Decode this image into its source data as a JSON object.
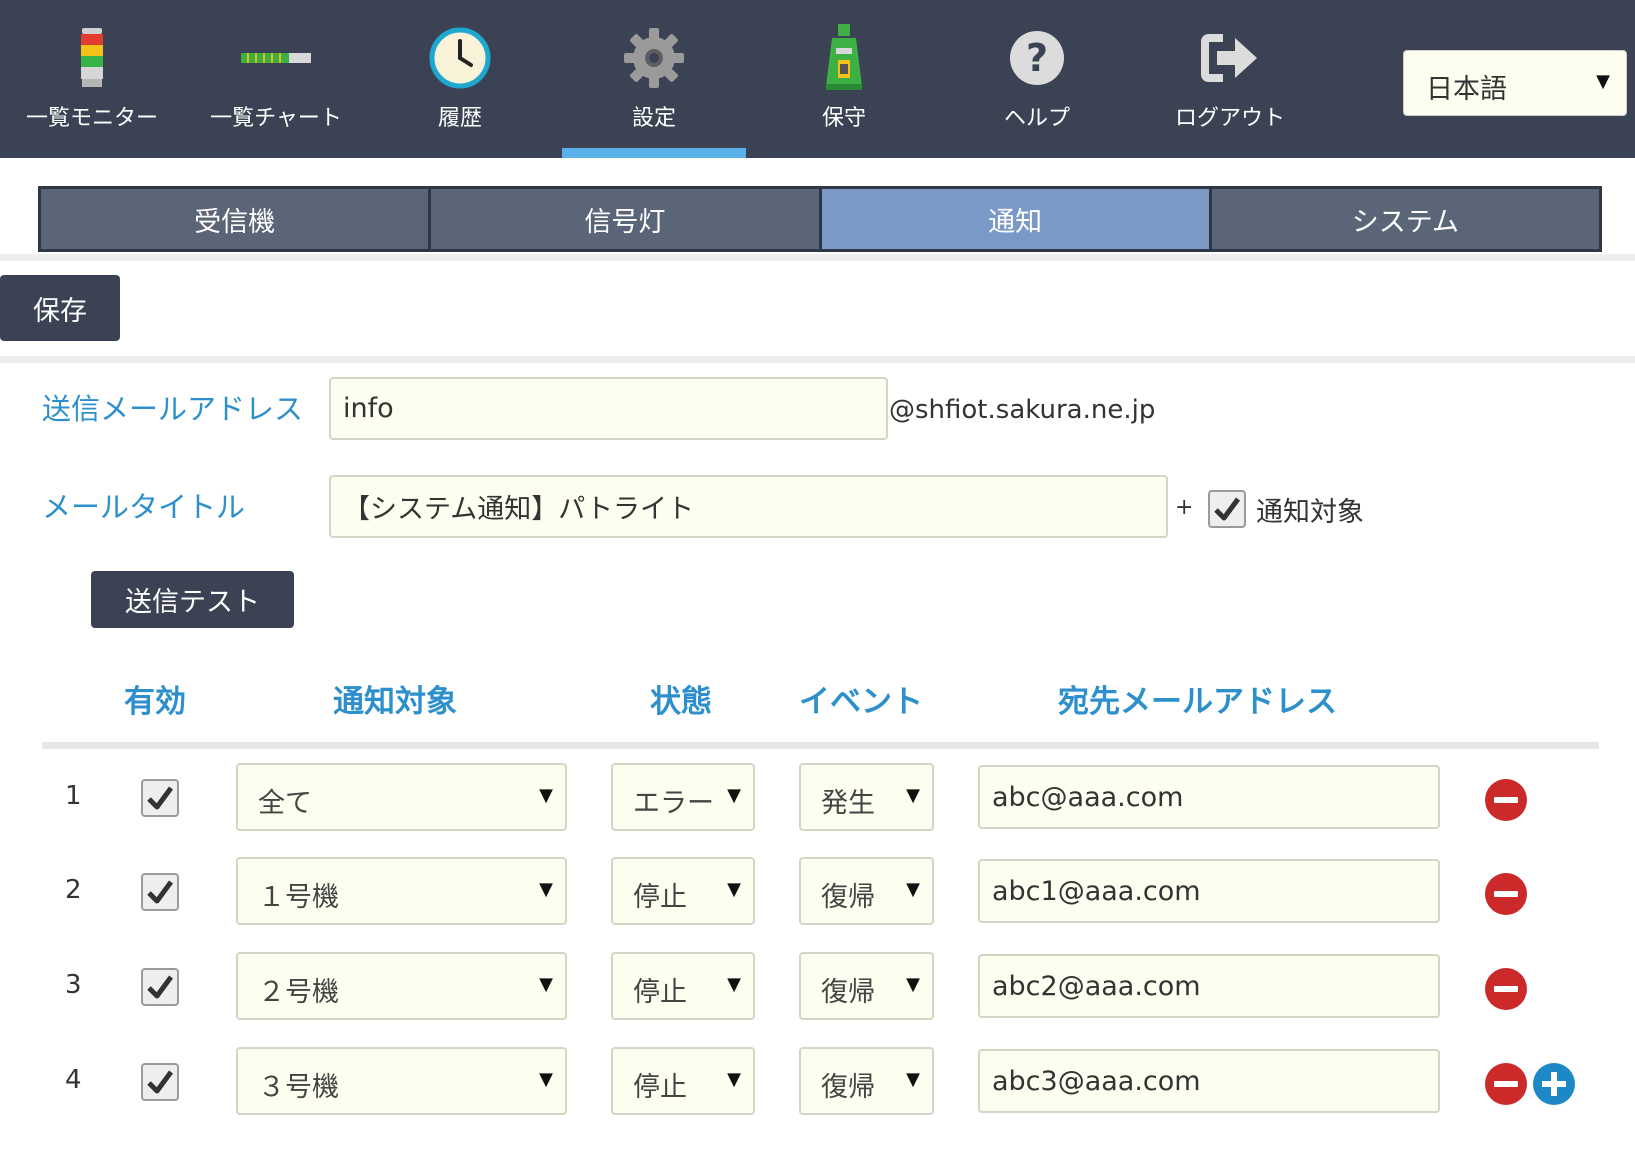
{
  "nav": {
    "items": [
      {
        "label": "一覧モニター",
        "icon": "signal-tower-icon"
      },
      {
        "label": "一覧チャート",
        "icon": "level-bar-icon"
      },
      {
        "label": "履歴",
        "icon": "clock-icon"
      },
      {
        "label": "設定",
        "icon": "gear-icon"
      },
      {
        "label": "保守",
        "icon": "maintenance-icon"
      },
      {
        "label": "ヘルプ",
        "icon": "question-icon"
      },
      {
        "label": "ログアウト",
        "icon": "logout-icon"
      }
    ],
    "active_index": 3,
    "language": "日本語"
  },
  "tabs": [
    "受信機",
    "信号灯",
    "通知",
    "システム"
  ],
  "active_tab": 2,
  "save_label": "保存",
  "form": {
    "sender_label": "送信メールアドレス",
    "sender_value": "info",
    "sender_domain": "@shfiot.sakura.ne.jp",
    "title_label": "メールタイトル",
    "title_value": "【システム通知】パトライト",
    "plus": "+",
    "append_target_label": "通知対象",
    "append_target_checked": true,
    "test_button": "送信テスト"
  },
  "table": {
    "headers": [
      "有効",
      "通知対象",
      "状態",
      "イベント",
      "宛先メールアドレス"
    ],
    "rows": [
      {
        "no": "1",
        "enabled": true,
        "target": "全て",
        "state": "エラー",
        "event": "発生",
        "email": "abc@aaa.com"
      },
      {
        "no": "2",
        "enabled": true,
        "target": "１号機",
        "state": "停止",
        "event": "復帰",
        "email": "abc1@aaa.com"
      },
      {
        "no": "3",
        "enabled": true,
        "target": "２号機",
        "state": "停止",
        "event": "復帰",
        "email": "abc2@aaa.com"
      },
      {
        "no": "4",
        "enabled": true,
        "target": "３号機",
        "state": "停止",
        "event": "復帰",
        "email": "abc3@aaa.com"
      }
    ],
    "remove_icon": "minus-circle-icon",
    "add_icon": "plus-circle-icon"
  },
  "colors": {
    "nav_bg": "#3a4253",
    "active_tab": "#7b99c6",
    "accent": "#2d8fcc",
    "input_bg": "#fdfdf0",
    "remove": "#cc2a2a",
    "add": "#1e88c7"
  }
}
